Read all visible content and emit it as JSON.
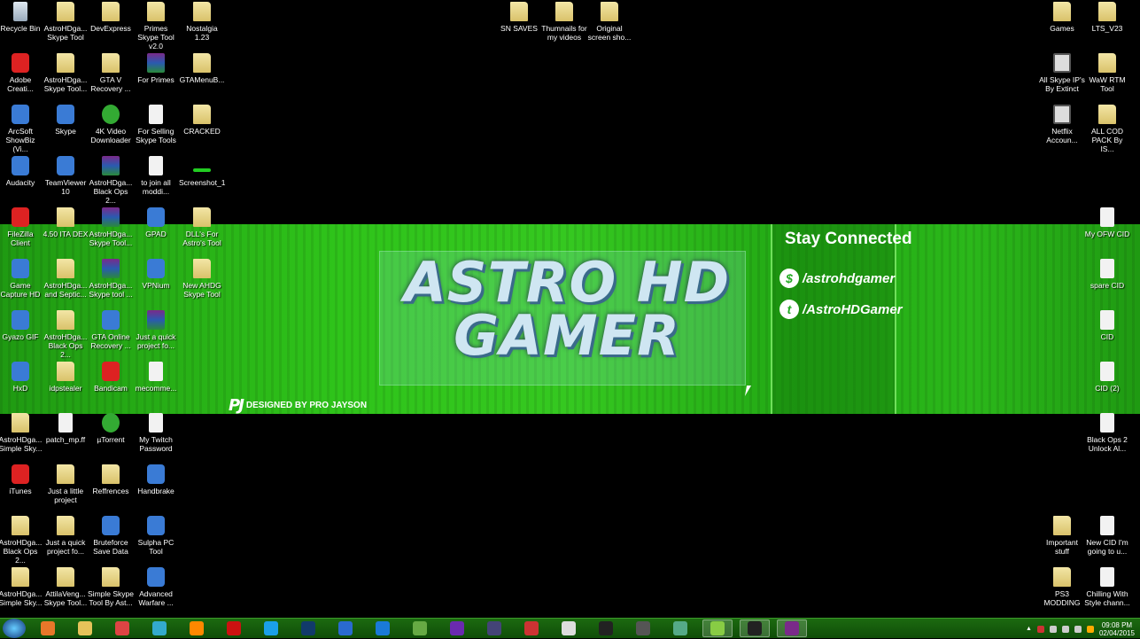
{
  "banner": {
    "title_line1": "ASTRO HD",
    "title_line2": "GAMER",
    "stay_connected": "Stay Connected",
    "handle_1": "/astrohdgamer",
    "handle_2": "/AstroHDGamer",
    "designed_by": "DESIGNED BY PRO JAYSON",
    "designer_logo": "PJ"
  },
  "desktop_icons": [
    {
      "label": "Recycle Bin",
      "icon": "recycle-bin"
    },
    {
      "label": "Adobe Creati...",
      "icon": "red"
    },
    {
      "label": "ArcSoft ShowBiz (Vi...",
      "icon": "app"
    },
    {
      "label": "Audacity",
      "icon": "app"
    },
    {
      "label": "FileZilla Client",
      "icon": "red"
    },
    {
      "label": "Game Capture HD",
      "icon": "app"
    },
    {
      "label": "Gyazo GIF",
      "icon": "app"
    },
    {
      "label": "HxD",
      "icon": "app"
    },
    {
      "label": "AstroHDga... Simple Sky...",
      "icon": "folder"
    },
    {
      "label": "iTunes",
      "icon": "red"
    },
    {
      "label": "AstroHDga... Black Ops 2...",
      "icon": "folder"
    },
    {
      "label": "AstroHDga... Simple Sky...",
      "icon": "folder"
    },
    {
      "label": "AstroHDga... Skype Tool",
      "icon": "folder"
    },
    {
      "label": "AstroHDga... Skype Tool...",
      "icon": "folder"
    },
    {
      "label": "Skype",
      "icon": "app"
    },
    {
      "label": "TeamViewer 10",
      "icon": "app"
    },
    {
      "label": "4.50 ITA DEX",
      "icon": "folder"
    },
    {
      "label": "AstroHDga... and Septic...",
      "icon": "folder"
    },
    {
      "label": "AstroHDga... Black Ops 2...",
      "icon": "folder"
    },
    {
      "label": "idpstealer",
      "icon": "folder"
    },
    {
      "label": "patch_mp.ff",
      "icon": "file"
    },
    {
      "label": "Just a little project",
      "icon": "folder"
    },
    {
      "label": "Just a quick project fo...",
      "icon": "folder"
    },
    {
      "label": "AttilaVeng... Skype Tool...",
      "icon": "folder"
    },
    {
      "label": "DevExpress",
      "icon": "folder"
    },
    {
      "label": "GTA V Recovery ...",
      "icon": "folder"
    },
    {
      "label": "4K Video Downloader",
      "icon": "green"
    },
    {
      "label": "AstroHDga... Black Ops 2...",
      "icon": "rar"
    },
    {
      "label": "AstroHDga... Skype Tool...",
      "icon": "rar"
    },
    {
      "label": "AstroHDga... Skype tool ...",
      "icon": "rar"
    },
    {
      "label": "GTA Online Recovery ...",
      "icon": "app"
    },
    {
      "label": "Bandicam",
      "icon": "red"
    },
    {
      "label": "µTorrent",
      "icon": "green"
    },
    {
      "label": "Reffrences",
      "icon": "folder"
    },
    {
      "label": "Bruteforce Save Data",
      "icon": "app"
    },
    {
      "label": "Simple Skype Tool By Ast...",
      "icon": "folder"
    },
    {
      "label": "Primes Skype Tool v2.0",
      "icon": "folder"
    },
    {
      "label": "For Primes",
      "icon": "rar"
    },
    {
      "label": "For Selling Skype Tools",
      "icon": "file"
    },
    {
      "label": "to join all moddi...",
      "icon": "file"
    },
    {
      "label": "GPAD",
      "icon": "app"
    },
    {
      "label": "VPNium",
      "icon": "app"
    },
    {
      "label": "Just a quick project fo...",
      "icon": "rar"
    },
    {
      "label": "mecomme...",
      "icon": "file"
    },
    {
      "label": "My Twitch Password",
      "icon": "file"
    },
    {
      "label": "Handbrake",
      "icon": "app"
    },
    {
      "label": "Sulpha PC Tool",
      "icon": "app"
    },
    {
      "label": "Advanced Warfare ...",
      "icon": "app"
    },
    {
      "label": "Nostalgia 1.23",
      "icon": "folder"
    },
    {
      "label": "GTAMenuB...",
      "icon": "folder"
    },
    {
      "label": "CRACKED",
      "icon": "folder"
    },
    {
      "label": "Screenshot_1",
      "icon": "bar"
    },
    {
      "label": "DLL's For Astro's Tool",
      "icon": "folder"
    },
    {
      "label": "New AHDG Skype Tool",
      "icon": "folder"
    },
    {
      "label": "SN SAVES",
      "icon": "folder"
    },
    {
      "label": "Thumnails for my videos",
      "icon": "folder"
    },
    {
      "label": "Original screen sho...",
      "icon": "folder"
    },
    {
      "label": "Games",
      "icon": "folder"
    },
    {
      "label": "All Skype IP's By Extinct",
      "icon": "window"
    },
    {
      "label": "Netflix Accoun...",
      "icon": "window"
    },
    {
      "label": "Important stuff",
      "icon": "folder"
    },
    {
      "label": "PS3 MODDING",
      "icon": "folder"
    },
    {
      "label": "LTS_V23",
      "icon": "folder"
    },
    {
      "label": "WaW RTM Tool",
      "icon": "folder"
    },
    {
      "label": "ALL COD PACK By IS...",
      "icon": "folder"
    },
    {
      "label": "My OFW CID",
      "icon": "file"
    },
    {
      "label": "spare CID",
      "icon": "file"
    },
    {
      "label": "CID",
      "icon": "file"
    },
    {
      "label": "CID (2)",
      "icon": "file"
    },
    {
      "label": "Black Ops 2 Unlock Al...",
      "icon": "file"
    },
    {
      "label": "New CID I'm going to u...",
      "icon": "file"
    },
    {
      "label": "Chilling With Style chann...",
      "icon": "file"
    }
  ],
  "taskbar": {
    "apps": [
      {
        "name": "media-player",
        "color": "#e8772a"
      },
      {
        "name": "file-explorer",
        "color": "#e6c35a"
      },
      {
        "name": "chrome",
        "color": "#d44"
      },
      {
        "name": "capture-tool",
        "color": "#3ac"
      },
      {
        "name": "app-orange",
        "color": "#f80"
      },
      {
        "name": "filezilla",
        "color": "#c11"
      },
      {
        "name": "skype",
        "color": "#1aa0e8"
      },
      {
        "name": "photoshop",
        "color": "#113a6a"
      },
      {
        "name": "media-app",
        "color": "#2a6ad0"
      },
      {
        "name": "teamviewer",
        "color": "#1a7ad8"
      },
      {
        "name": "app-gear",
        "color": "#6a4"
      },
      {
        "name": "visual-studio",
        "color": "#6a2ab0"
      },
      {
        "name": "app-infinity",
        "color": "#447"
      },
      {
        "name": "popcorn-time",
        "color": "#c33"
      },
      {
        "name": "notepad",
        "color": "#ddd"
      },
      {
        "name": "app-pen",
        "color": "#222"
      },
      {
        "name": "app-game",
        "color": "#555"
      },
      {
        "name": "app-shield",
        "color": "#5a8"
      },
      {
        "name": "notepad-plus",
        "color": "#8c4"
      },
      {
        "name": "obs",
        "color": "#222"
      },
      {
        "name": "winrar",
        "color": "#7a2a8a"
      }
    ],
    "time": "09:08 PM",
    "date": "02/04/2015"
  }
}
